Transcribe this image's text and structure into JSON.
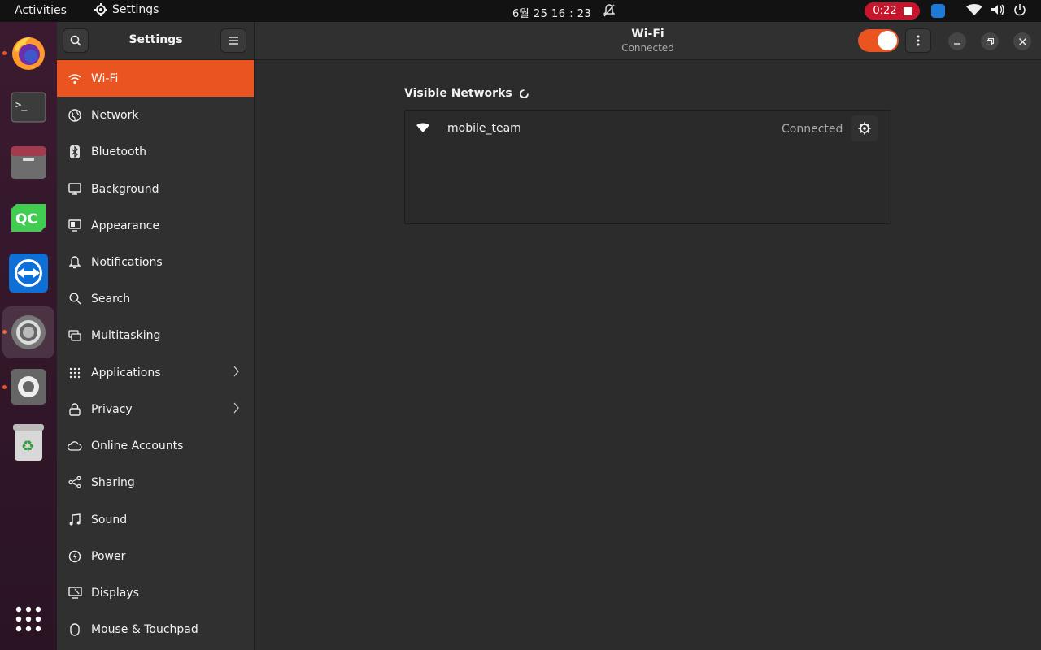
{
  "topbar": {
    "activities": "Activities",
    "app_name": "Settings",
    "clock": "6월 25  16 : 23",
    "recording_time": "0:22"
  },
  "dock": {
    "apps": [
      "firefox-icon",
      "terminal-icon",
      "files-icon",
      "qt-creator-icon",
      "teamviewer-icon",
      "settings-icon",
      "settings-alt-icon",
      "trash-icon",
      "app-grid-icon"
    ],
    "qt_label": "QC"
  },
  "sidebar": {
    "title": "Settings",
    "items": [
      {
        "label": "Wi-Fi",
        "icon": "wifi-icon"
      },
      {
        "label": "Network",
        "icon": "globe-icon"
      },
      {
        "label": "Bluetooth",
        "icon": "bluetooth-icon"
      },
      {
        "label": "Background",
        "icon": "monitor-icon"
      },
      {
        "label": "Appearance",
        "icon": "appearance-icon"
      },
      {
        "label": "Notifications",
        "icon": "bell-icon"
      },
      {
        "label": "Search",
        "icon": "search-icon"
      },
      {
        "label": "Multitasking",
        "icon": "multitasking-icon"
      },
      {
        "label": "Applications",
        "icon": "apps-icon"
      },
      {
        "label": "Privacy",
        "icon": "lock-icon"
      },
      {
        "label": "Online Accounts",
        "icon": "cloud-icon"
      },
      {
        "label": "Sharing",
        "icon": "share-icon"
      },
      {
        "label": "Sound",
        "icon": "music-icon"
      },
      {
        "label": "Power",
        "icon": "power-icon"
      },
      {
        "label": "Displays",
        "icon": "display-icon"
      },
      {
        "label": "Mouse & Touchpad",
        "icon": "mouse-icon"
      }
    ]
  },
  "header": {
    "title": "Wi-Fi",
    "subtitle": "Connected",
    "wifi_enabled": true
  },
  "content": {
    "visible_networks_title": "Visible Networks",
    "networks": [
      {
        "ssid": "mobile_team",
        "status": "Connected"
      }
    ]
  },
  "colors": {
    "accent": "#e95420",
    "panel": "#303030",
    "background": "#2c2c2c"
  }
}
